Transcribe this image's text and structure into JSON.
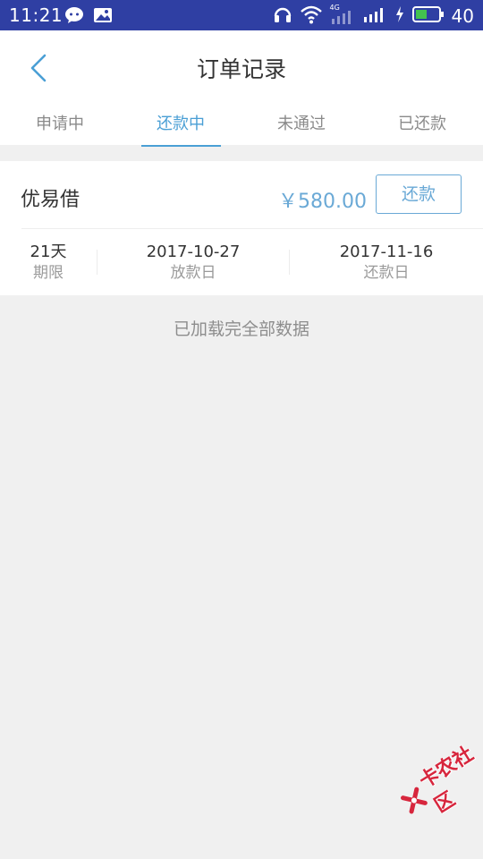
{
  "status_bar": {
    "time": "11:21",
    "network_label": "4G",
    "battery_level": "40"
  },
  "header": {
    "title": "订单记录"
  },
  "tabs": [
    {
      "label": "申请中",
      "active": false
    },
    {
      "label": "还款中",
      "active": true
    },
    {
      "label": "未通过",
      "active": false
    },
    {
      "label": "已还款",
      "active": false
    }
  ],
  "order": {
    "lender": "优易借",
    "amount": "￥580.00",
    "action_label": "还款",
    "term": {
      "value": "21天",
      "label": "期限"
    },
    "loan_date": {
      "value": "2017-10-27",
      "label": "放款日"
    },
    "repay_date": {
      "value": "2017-11-16",
      "label": "还款日"
    }
  },
  "list_end_text": "已加载完全部数据",
  "colors": {
    "status_bar": "#2f3fa3",
    "accent": "#4a9fd5",
    "watermark": "#d7263d"
  },
  "watermark": {
    "text": "卡农社区",
    "icon": "kanong-logo-icon"
  }
}
